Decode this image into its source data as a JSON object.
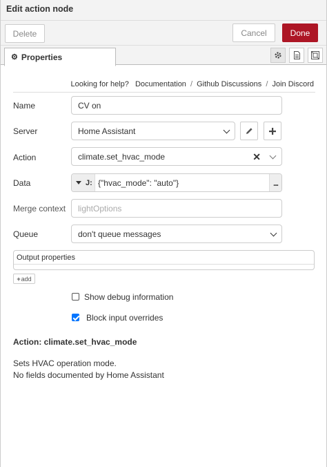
{
  "header": {
    "title": "Edit action node"
  },
  "toolbar": {
    "delete_label": "Delete",
    "cancel_label": "Cancel",
    "done_label": "Done"
  },
  "tabs": {
    "properties_label": "Properties",
    "side_icons": [
      "gear-icon",
      "document-icon",
      "layout-icon"
    ]
  },
  "help": {
    "prefix": "Looking for help?",
    "links": [
      "Documentation",
      "Github Discussions",
      "Join Discord"
    ]
  },
  "form": {
    "name": {
      "label": "Name",
      "value": "CV on"
    },
    "server": {
      "label": "Server",
      "value": "Home Assistant"
    },
    "action": {
      "label": "Action",
      "value": "climate.set_hvac_mode"
    },
    "data": {
      "label": "Data",
      "type_icon": "J:",
      "value": "{\"hvac_mode\": \"auto\"}",
      "more": "..."
    },
    "merge_context": {
      "label": "Merge context",
      "placeholder": "lightOptions"
    },
    "queue": {
      "label": "Queue",
      "value": "don't queue messages"
    }
  },
  "output": {
    "header": "Output properties",
    "add_label": "add"
  },
  "options": {
    "show_debug": {
      "label": "Show debug information",
      "checked": false
    },
    "block_overrides": {
      "label": "Block input overrides",
      "checked": true
    }
  },
  "info": {
    "title": "Action: climate.set_hvac_mode",
    "line1": "Sets HVAC operation mode.",
    "line2": "No fields documented by Home Assistant"
  },
  "colors": {
    "accent": "#ad1625",
    "checkbox": "#0075ff"
  }
}
